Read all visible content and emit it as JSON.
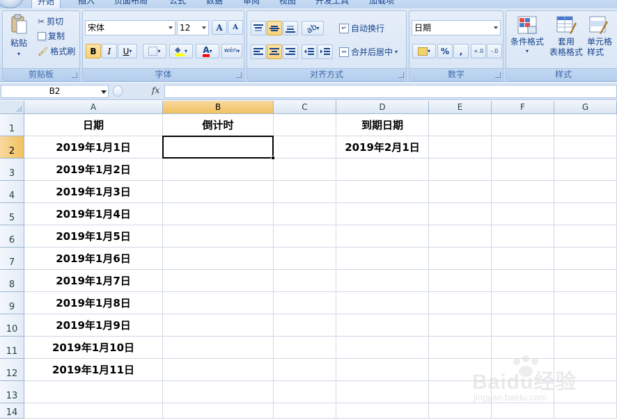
{
  "ribbon": {
    "tabs": [
      "开始",
      "插入",
      "页面布局",
      "公式",
      "数据",
      "审阅",
      "视图",
      "开发工具",
      "加载项"
    ],
    "clipboard": {
      "paste": "粘贴",
      "cut": "剪切",
      "copy": "复制",
      "format_painter": "格式刷",
      "label": "剪贴板"
    },
    "font": {
      "name": "宋体",
      "size": "12",
      "label": "字体",
      "bold": "B",
      "italic": "I",
      "underline": "U",
      "grow": "A",
      "shrink": "A",
      "font_color_glyph": "A",
      "phonetic_glyph": "wén"
    },
    "alignment": {
      "wrap_text": "自动换行",
      "merge_center": "合并后居中",
      "label": "对齐方式"
    },
    "number": {
      "format": "日期",
      "percent": "%",
      "comma": ",",
      "label": "数字",
      "inc_decimal": "+.0",
      "dec_decimal": "-.0"
    },
    "styles": {
      "conditional": "条件格式",
      "table_format_1": "套用",
      "table_format_2": "表格格式",
      "cell_styles_1": "单元格",
      "cell_styles_2": "样式",
      "label": "样式"
    }
  },
  "formula_bar": {
    "name_box": "B2",
    "fx": "fx",
    "content": ""
  },
  "columns": [
    "A",
    "B",
    "C",
    "D",
    "E",
    "F",
    "G"
  ],
  "rows": [
    "1",
    "2",
    "3",
    "4",
    "5",
    "6",
    "7",
    "8",
    "9",
    "10",
    "11",
    "12",
    "13",
    "14"
  ],
  "cells": {
    "A1": "日期",
    "B1": "倒计时",
    "D1": "到期日期",
    "A2": "2019年1月1日",
    "A3": "2019年1月2日",
    "A4": "2019年1月3日",
    "A5": "2019年1月4日",
    "A6": "2019年1月5日",
    "A7": "2019年1月6日",
    "A8": "2019年1月7日",
    "A9": "2019年1月8日",
    "A10": "2019年1月9日",
    "A11": "2019年1月10日",
    "A12": "2019年1月11日",
    "D2": "2019年2月1日"
  },
  "selection": {
    "cell": "B2",
    "column": "B",
    "row": "2"
  },
  "watermark": {
    "text": "Baidu经验",
    "sub": "jingyan.baidu.com"
  },
  "colors": {
    "accent": "#f1c15f",
    "ribbon": "#dfe9f5",
    "header": "#dbe6f3"
  }
}
